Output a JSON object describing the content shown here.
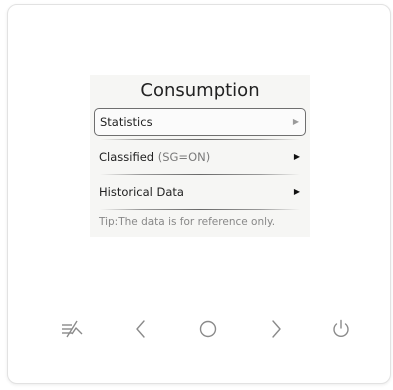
{
  "screen": {
    "title": "Consumption",
    "items": [
      {
        "label": "Statistics",
        "sub": "",
        "selected": true
      },
      {
        "label": "Classified",
        "sub": "(SG=ON)",
        "selected": false
      },
      {
        "label": "Historical Data",
        "sub": "",
        "selected": false
      }
    ],
    "tip": "Tip:The data is for reference only."
  },
  "buttons": [
    {
      "icon": "mode-icon"
    },
    {
      "icon": "chevron-left-icon"
    },
    {
      "icon": "home-circle-icon"
    },
    {
      "icon": "chevron-right-icon"
    },
    {
      "icon": "power-icon"
    }
  ],
  "colors": {
    "screen_bg": "#f6f6f4",
    "icon_stroke": "#8a8a8a",
    "selection_border": "#6f6f6f"
  }
}
